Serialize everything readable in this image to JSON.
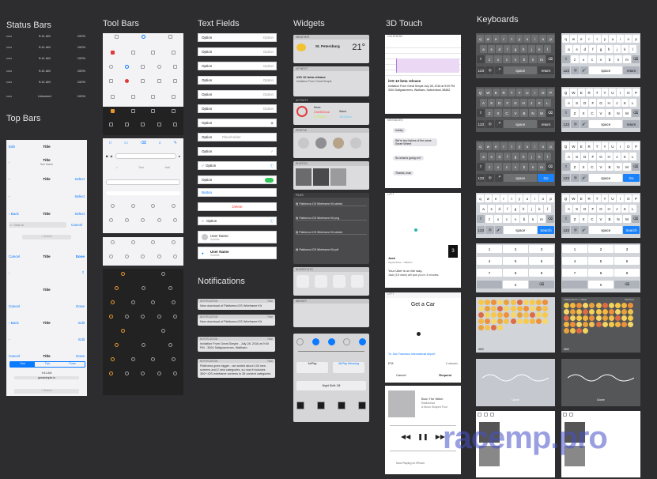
{
  "columns": {
    "status_bars": "Status Bars",
    "top_bars": "Top Bars",
    "tool_bars": "Tool Bars",
    "text_fields": "Text Fields",
    "notifications": "Notifications",
    "widgets": "Widgets",
    "touch3d": "3D Touch",
    "keyboards": "Keyboards"
  },
  "status_bars": {
    "rows": [
      {
        "left": "•••••",
        "mid": "9:41 AM",
        "right": "100%"
      },
      {
        "left": "•••••",
        "mid": "9:41 AM",
        "right": "100%"
      },
      {
        "left": "•••••",
        "mid": "9:41 AM",
        "right": "100%"
      },
      {
        "left": "•••••",
        "mid": "9:41 AM",
        "right": "100%"
      },
      {
        "left": "•••••",
        "mid": "9:41 AM",
        "right": "100%"
      },
      {
        "left": "•••••",
        "mid": "Unlocked",
        "right": "100%"
      }
    ]
  },
  "top_bars": {
    "edit": "Edit",
    "title": "Title",
    "subtitle": "Sub Name",
    "select": "Select",
    "back": "Back",
    "search": "Search",
    "cancel": "Cancel",
    "done": "Done",
    "tabs": [
      "One",
      "Two",
      "Three"
    ],
    "time": "9:41 AM",
    "url": "greatsimple.io"
  },
  "text_fields": {
    "option": "Option",
    "placeholder": "Placeholder",
    "button": "Button",
    "delete": "Delete",
    "user_name": "User Name",
    "user_sub": "Subtitle"
  },
  "notifications": {
    "items": [
      {
        "app": "NOTIFICATION",
        "time": "Time",
        "body": "New download of Platforma iOS Wireframe Kit"
      },
      {
        "app": "NOTIFICATION",
        "time": "Time",
        "body": "New download of Platforma iOS Wireframe Kit"
      },
      {
        "app": "NOTIFICATION",
        "time": "Time",
        "body": "Invitation From Great Simple - July 28, 2016 at 9:00 PM - 3304 Saltgosmenes, Waltham"
      },
      {
        "app": "NOTIFICATION",
        "time": "Time",
        "body": "Platforma goes bigger - we added about 100 new screens and 2 new categories, so now it includes 300+ iOS wireframe screens in 28 content categories"
      }
    ]
  },
  "widgets": {
    "weather_city": "St. Petersburg",
    "weather_temp": "21°",
    "release_title": "iOS 10 beta release",
    "release_body": "Invitation From Great Simple",
    "moves": "Move",
    "moves_val": "236/500cal",
    "stand": "Stand",
    "stand_val": "18/12hrs",
    "exercise_val": "25/30min",
    "files": [
      "Platforma iOS Wireframe Kit.sketch",
      "Platforma iOS Wireframe Kit.png",
      "Platforma iOS Wireframe Kit.sketch",
      "Platforma iOS Wireframe Kit.pdf"
    ],
    "airplay": "AirPlay",
    "airplay_sub": "AirPlay Mirroring",
    "night_shift": "Night Shift: Off"
  },
  "touch3d": {
    "calendar_label": "CALENDAR",
    "event_title": "iOS 10 beta release",
    "event_body": "Invitation From Great Simple July 28, 2016 at 9:00 PM 3304 Saltgosmenes, Waltham, Switzerland, 88482",
    "messages_label": "MESSAGES",
    "msgs": [
      "hubby",
      "We're two halves of the same Smart Wheel",
      "So what is going on?",
      "Thanks, man"
    ],
    "lyft_label": "LYFT",
    "driver": "Jack",
    "car": "Toyota Prius - 704ACC",
    "plate_num": "3",
    "ride_status": "Your Uber is on the way.",
    "ride_body": "Jack (3.5 stars) will pick you in 3 minutes.",
    "get_car": "Get a Car",
    "to_label": "To: San Francisco International Airport",
    "eta": "ETA",
    "eta_val": "5 minutes",
    "cancel": "Cancel",
    "request": "Request",
    "song": "Burn The Witch",
    "artist": "Radiohead",
    "album": "A Moon Shaped Pool",
    "now_playing": "Now Playing on iPhone"
  },
  "keyboards": {
    "row1": [
      "q",
      "w",
      "e",
      "r",
      "t",
      "y",
      "u",
      "i",
      "o",
      "p"
    ],
    "row2": [
      "a",
      "s",
      "d",
      "f",
      "g",
      "h",
      "j",
      "k",
      "l"
    ],
    "row3": [
      "z",
      "x",
      "c",
      "v",
      "b",
      "n",
      "m"
    ],
    "row1u": [
      "Q",
      "W",
      "E",
      "R",
      "T",
      "Y",
      "U",
      "I",
      "O",
      "P"
    ],
    "row2u": [
      "A",
      "S",
      "D",
      "F",
      "G",
      "H",
      "J",
      "K",
      "L"
    ],
    "row3u": [
      "Z",
      "X",
      "C",
      "V",
      "B",
      "N",
      "M"
    ],
    "space": "space",
    "return": "return",
    "go": "Go",
    "search": "Search",
    "num": "123",
    "numpad": [
      [
        "1",
        "2",
        "3"
      ],
      [
        "4",
        "5",
        "6"
      ],
      [
        "7",
        "8",
        "9"
      ],
      [
        "",
        "0",
        ""
      ]
    ],
    "done": "Done",
    "abc": "ABC",
    "frequently": "FREQUENTLY USED",
    "people": "PEOPLE"
  },
  "watermark": "racemp.pro",
  "colors": {
    "bg": "#2d2d2f",
    "accent": "#0a7aff",
    "orange": "#e8962e",
    "green": "#34c759"
  }
}
